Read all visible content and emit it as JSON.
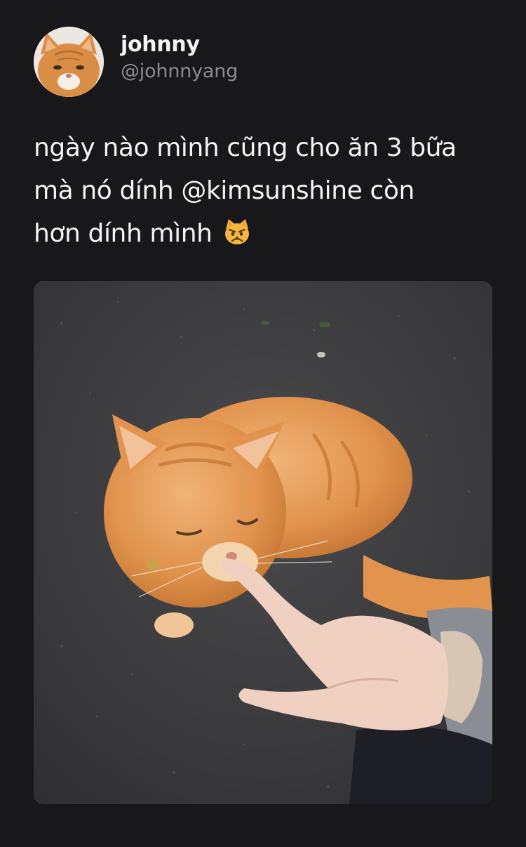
{
  "tweet": {
    "author": {
      "display_name": "johnny",
      "handle": "@johnnyang",
      "avatar_icon": "cat-face-avatar"
    },
    "text_lines": [
      "ngày nào mình cũng cho ăn 3 bữa",
      "mà nó dính @kimsunshine còn",
      "hơn dính mình"
    ],
    "emoji": "pouting-cat-emoji",
    "media": {
      "type": "photo",
      "subject": "orange tabby cat on asphalt touched by a finger"
    }
  },
  "colors": {
    "background": "#18181b",
    "primary_text": "#f4f4f5",
    "secondary_text": "#8b8b92",
    "cat_orange": "#e39a52"
  }
}
